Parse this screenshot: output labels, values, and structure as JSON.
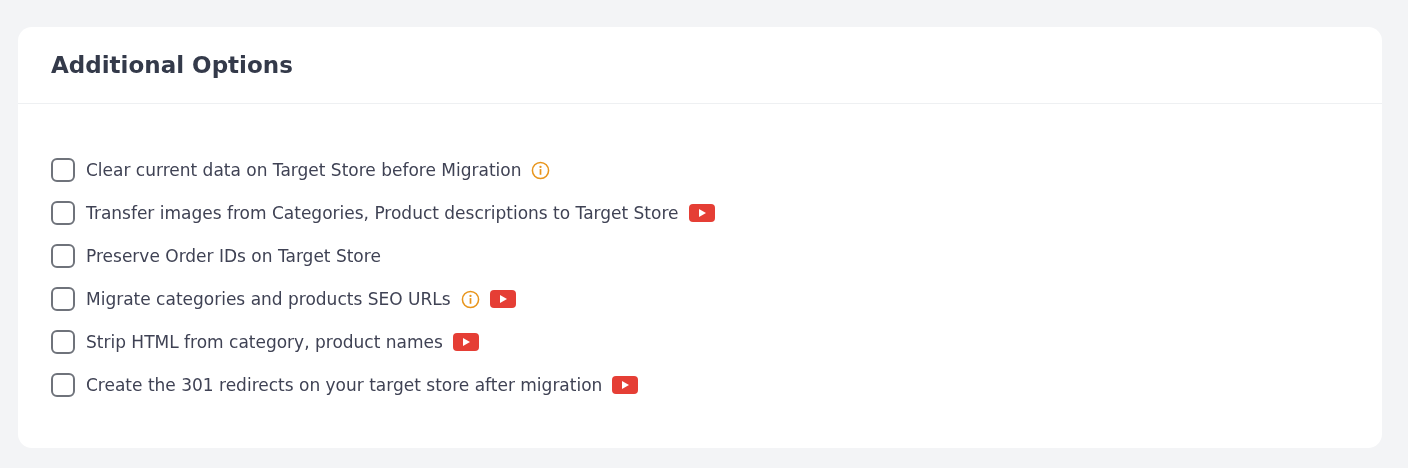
{
  "card": {
    "title": "Additional Options",
    "options": [
      {
        "label": "Clear current data on Target Store before Migration",
        "checked": false,
        "info": true,
        "video": false
      },
      {
        "label": "Transfer images from Categories, Product descriptions to Target Store",
        "checked": false,
        "info": false,
        "video": true
      },
      {
        "label": "Preserve Order IDs on Target Store",
        "checked": false,
        "info": false,
        "video": false
      },
      {
        "label": "Migrate categories and products SEO URLs",
        "checked": false,
        "info": true,
        "video": true
      },
      {
        "label": "Strip HTML from category, product names",
        "checked": false,
        "info": false,
        "video": true
      },
      {
        "label": "Create the 301 redirects on your target store after migration",
        "checked": false,
        "info": false,
        "video": true
      }
    ]
  }
}
